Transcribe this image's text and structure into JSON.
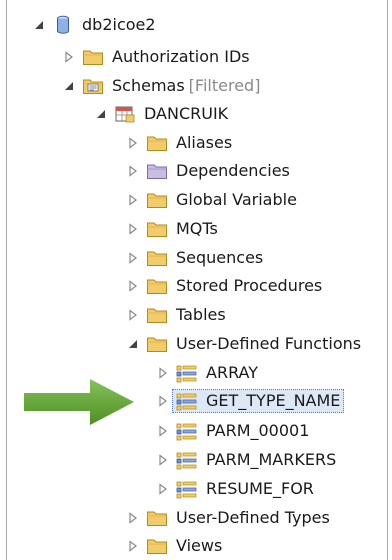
{
  "tree": {
    "root": {
      "label": "db2icoe2"
    },
    "authorization": {
      "label": "Authorization IDs"
    },
    "schemas": {
      "label": "Schemas",
      "suffix": "[Filtered]"
    },
    "dancruik": {
      "label": "DANCRUIK"
    },
    "aliases": {
      "label": "Aliases"
    },
    "dependencies": {
      "label": "Dependencies"
    },
    "global_variable": {
      "label": "Global Variable"
    },
    "mqts": {
      "label": "MQTs"
    },
    "sequences": {
      "label": "Sequences"
    },
    "stored_procedures": {
      "label": "Stored Procedures"
    },
    "tables": {
      "label": "Tables"
    },
    "udf": {
      "label": "User-Defined Functions"
    },
    "fn_array": {
      "label": "ARRAY"
    },
    "fn_get_type_name": {
      "label": "GET_TYPE_NAME"
    },
    "fn_parm_00001": {
      "label": "PARM_00001"
    },
    "fn_parm_markers": {
      "label": "PARM_MARKERS"
    },
    "fn_resume_for": {
      "label": "RESUME_FOR"
    },
    "udt": {
      "label": "User-Defined Types"
    },
    "views": {
      "label": "Views"
    }
  },
  "colors": {
    "arrow": "#5aa02c",
    "folder": "#f2cc6a",
    "folder_purple": "#b9a9d6",
    "selection": "#dde8f7"
  },
  "icons": {
    "expanded": "triangle-down-icon",
    "collapsed": "triangle-right-icon",
    "database": "database-icon",
    "folder": "folder-icon",
    "schema": "schema-icon",
    "function": "function-icon"
  }
}
